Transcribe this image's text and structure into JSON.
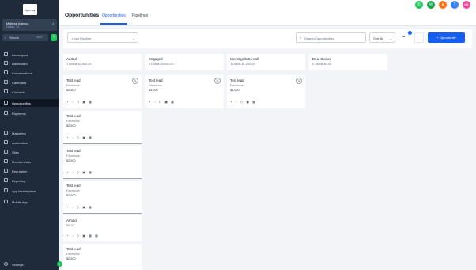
{
  "sidebar": {
    "logo_text": "Agency",
    "account": {
      "name": "Maltese Agency",
      "location": "Dallas, TX"
    },
    "search": {
      "placeholder": "Search",
      "shortcut": "ctrl K",
      "plus": "+"
    },
    "items": [
      {
        "label": "Launchpad",
        "icon": "rocket-icon"
      },
      {
        "label": "Dashboard",
        "icon": "dashboard-icon"
      },
      {
        "label": "Conversations",
        "icon": "chat-icon"
      },
      {
        "label": "Calendars",
        "icon": "calendar-icon"
      },
      {
        "label": "Contacts",
        "icon": "contacts-icon"
      },
      {
        "label": "Opportunities",
        "icon": "funnel-icon",
        "active": true
      },
      {
        "label": "Payments",
        "icon": "payments-icon"
      },
      {
        "label": "Marketing",
        "icon": "megaphone-icon"
      },
      {
        "label": "Automation",
        "icon": "automation-icon"
      },
      {
        "label": "Sites",
        "icon": "globe-icon"
      },
      {
        "label": "Memberships",
        "icon": "membership-icon"
      },
      {
        "label": "Reputation",
        "icon": "star-icon"
      },
      {
        "label": "Reporting",
        "icon": "chart-icon"
      },
      {
        "label": "App Marketplace",
        "icon": "apps-icon"
      },
      {
        "label": "Mobile App",
        "icon": "phone-icon"
      }
    ],
    "settings_label": "Settings",
    "collapse_glyph": "‹"
  },
  "header": {
    "title": "Opportunities",
    "tabs": [
      {
        "label": "Opportunities",
        "active": true
      },
      {
        "label": "Pipelines",
        "active": false
      }
    ],
    "quick_actions": [
      {
        "icon": "phone-icon",
        "color": "#22c55e",
        "glyph": "✆"
      },
      {
        "icon": "megaphone-icon",
        "color": "#16a34a",
        "glyph": "✉"
      },
      {
        "icon": "bell-icon",
        "color": "#f97316",
        "glyph": "●"
      },
      {
        "icon": "help-icon",
        "color": "#3b82f6",
        "glyph": "?"
      },
      {
        "icon": "avatar",
        "color": "#ec4899",
        "glyph": "MA"
      }
    ]
  },
  "filters": {
    "pipeline_value": "Lead Pipeline",
    "search_placeholder": "Search Opportunities",
    "sort_value": "Sort By",
    "filter_glyph": "⏷",
    "add_button": "+ Opportunity"
  },
  "columns": [
    {
      "title": "Added",
      "summary": "1 Leads  $2,500.00"
    },
    {
      "title": "Engaged",
      "summary": "1 Leads  $3,000.00"
    },
    {
      "title": "Meetings/Intro call",
      "summary": "1 Leads  $1,500.00"
    },
    {
      "title": "Deal Closed",
      "summary": "0 Leads  $0.00"
    }
  ],
  "cards": [
    {
      "name": "Test lead",
      "source": "Facebook",
      "value": "$2,500",
      "avatar": "TL",
      "actions": "◔ ◌ ◇ ▣ ▦"
    },
    {
      "name": "Test lead",
      "source": "Facebook",
      "value": "$3,000",
      "avatar": "TL",
      "actions": "◔ ◌ ◇ ▣ ▦"
    },
    {
      "name": "Test lead",
      "source": "Facebook",
      "value": "$1,500",
      "avatar": "TL",
      "actions": "◔ ◌ ◇ ▣ ▦"
    },
    {
      "name": "Test lead",
      "source": "Facebook",
      "value": "$2,500",
      "avatar": "",
      "actions": "◔ ◌ ◇ ▣ ▦"
    },
    {
      "name": "Test lead",
      "source": "Facebook",
      "value": "$2,500",
      "avatar": "",
      "actions": "◔ ◌ ◇ ▣ ▦"
    },
    {
      "name": "Test lead",
      "source": "Facebook",
      "value": "$2,500",
      "avatar": "",
      "actions": "◔ ◌ ◇ ▣ ▦"
    },
    {
      "name": "Arnold",
      "source": "$0.00",
      "value": "",
      "avatar": "",
      "actions": "◔ ◌ ◇ ▣ ▦ ▦"
    },
    {
      "name": "Test lead",
      "source": "Facebook",
      "value": "$2,500",
      "avatar": "",
      "actions": "◔ ◌ ◇ ▣ ▦"
    }
  ]
}
